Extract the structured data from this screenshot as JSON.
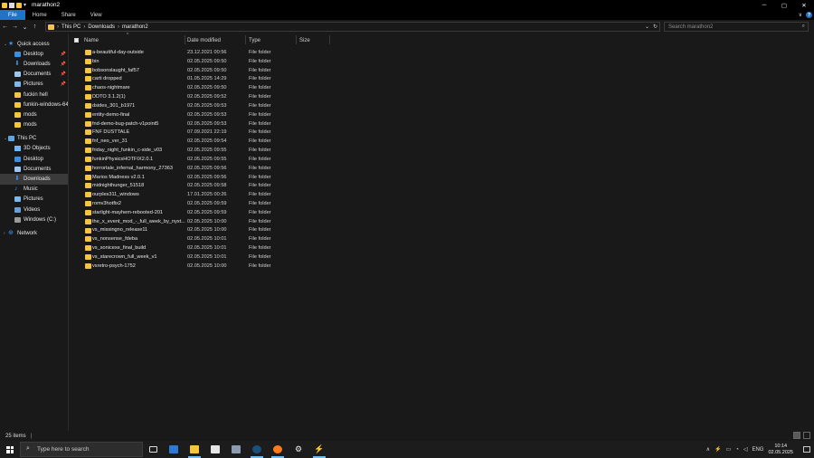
{
  "window": {
    "title": "marathon2",
    "controls": {
      "minimize": "─",
      "maximize": "▢",
      "close": "✕"
    }
  },
  "ribbon": {
    "tabs": [
      "File",
      "Home",
      "Share",
      "View"
    ]
  },
  "address": {
    "crumbs": [
      "This PC",
      "Downloads",
      "marathon2"
    ],
    "search_placeholder": "Search marathon2"
  },
  "sidebar": {
    "quick_access": "Quick access",
    "quick_items": [
      "Desktop",
      "Downloads",
      "Documents",
      "Pictures",
      "fuckin hell",
      "funkin-windows-64bit",
      "mods",
      "mods"
    ],
    "this_pc": "This PC",
    "pc_items": [
      "3D Objects",
      "Desktop",
      "Documents",
      "Downloads",
      "Music",
      "Pictures",
      "Videos",
      "Windows (C:)"
    ],
    "network": "Network"
  },
  "columns": {
    "name": "Name",
    "date": "Date modified",
    "type": "Type",
    "size": "Size"
  },
  "files": [
    {
      "name": "a-beautiful-day-outside",
      "date": "23.12.2021 00:56",
      "type": "File folder"
    },
    {
      "name": "bin",
      "date": "02.05.2025 09:50",
      "type": "File folder"
    },
    {
      "name": "bobsonslaught_faf57",
      "date": "02.05.2025 09:50",
      "type": "File folder"
    },
    {
      "name": "carti dropped",
      "date": "01.05.2025 14:29",
      "type": "File folder"
    },
    {
      "name": "chaos-nightmare",
      "date": "02.05.2025 09:50",
      "type": "File folder"
    },
    {
      "name": "DDTO 3.1.2(1)",
      "date": "02.05.2025 09:52",
      "type": "File folder"
    },
    {
      "name": "dsides_301_b1971",
      "date": "02.05.2025 09:53",
      "type": "File folder"
    },
    {
      "name": "entity-demo-final",
      "date": "02.05.2025 09:53",
      "type": "File folder"
    },
    {
      "name": "fnd-demo-bug-patch-v1point5",
      "date": "02.05.2025 09:53",
      "type": "File folder"
    },
    {
      "name": "FNF DUSTTALE",
      "date": "07.09.2021 22:19",
      "type": "File folder"
    },
    {
      "name": "fnf_neo_ver_31",
      "date": "02.05.2025 09:54",
      "type": "File folder"
    },
    {
      "name": "friday_night_funkin_c-side_v03",
      "date": "02.05.2025 09:55",
      "type": "File folder"
    },
    {
      "name": "funkinPhysicsHOTFIX2.0.1",
      "date": "02.05.2025 09:55",
      "type": "File folder"
    },
    {
      "name": "horrortale_infernal_harmony_27363",
      "date": "02.05.2025 09:56",
      "type": "File folder"
    },
    {
      "name": "Marios Madness v2.0.1",
      "date": "02.05.2025 09:56",
      "type": "File folder"
    },
    {
      "name": "midnighthunger_51518",
      "date": "02.05.2025 09:58",
      "type": "File folder"
    },
    {
      "name": "ourples311_windows",
      "date": "17.01.2025 00:26",
      "type": "File folder"
    },
    {
      "name": "romv3hotfix2",
      "date": "02.05.2025 09:59",
      "type": "File folder"
    },
    {
      "name": "starlight-mayhem-rebooted-201",
      "date": "02.05.2025 09:59",
      "type": "File folder"
    },
    {
      "name": "the_x_event_mod_-_full_week_by_nyxt...",
      "date": "02.05.2025 10:00",
      "type": "File folder"
    },
    {
      "name": "vs_missingno_release11",
      "date": "02.05.2025 10:00",
      "type": "File folder"
    },
    {
      "name": "vs_nonsense_fdeba",
      "date": "02.05.2025 10:01",
      "type": "File folder"
    },
    {
      "name": "vs_sonicexe_final_build",
      "date": "02.05.2025 10:01",
      "type": "File folder"
    },
    {
      "name": "vs_starecrown_full_week_v1",
      "date": "02.05.2025 10:01",
      "type": "File folder"
    },
    {
      "name": "vsretro-psych-1752",
      "date": "02.05.2025 10:00",
      "type": "File folder"
    }
  ],
  "status": {
    "count": "25 items"
  },
  "taskbar": {
    "search_placeholder": "Type here to search",
    "lang": "ENG",
    "time": "10:14",
    "date": "02.05.2025"
  },
  "colors": {
    "accent": "#1f73c9",
    "folder": "#f5c542",
    "background": "#191919"
  }
}
